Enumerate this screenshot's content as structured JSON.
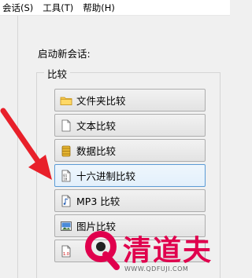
{
  "menu": [
    {
      "label": "会话(S)"
    },
    {
      "label": "工具(T)"
    },
    {
      "label": "帮助(H)"
    }
  ],
  "session": {
    "start_label": "启动新会话:",
    "group_title": "比较",
    "buttons": [
      {
        "label": "文件夹比较",
        "icon": "folder-icon"
      },
      {
        "label": "文本比较",
        "icon": "text-file-icon"
      },
      {
        "label": "数据比较",
        "icon": "database-icon"
      },
      {
        "label": "十六进制比较",
        "icon": "hex-file-icon",
        "focused": true
      },
      {
        "label": "MP3 比较",
        "icon": "music-file-icon"
      },
      {
        "label": "图片比较",
        "icon": "picture-icon"
      },
      {
        "label": "",
        "icon": "version-file-icon"
      }
    ]
  },
  "watermark": {
    "text": "清道夫",
    "url": "WWW.QDFUJI.COM",
    "color": "#e0004d"
  },
  "colors": {
    "arrow": "#e8202a",
    "focus_border": "#5b9bd5"
  }
}
